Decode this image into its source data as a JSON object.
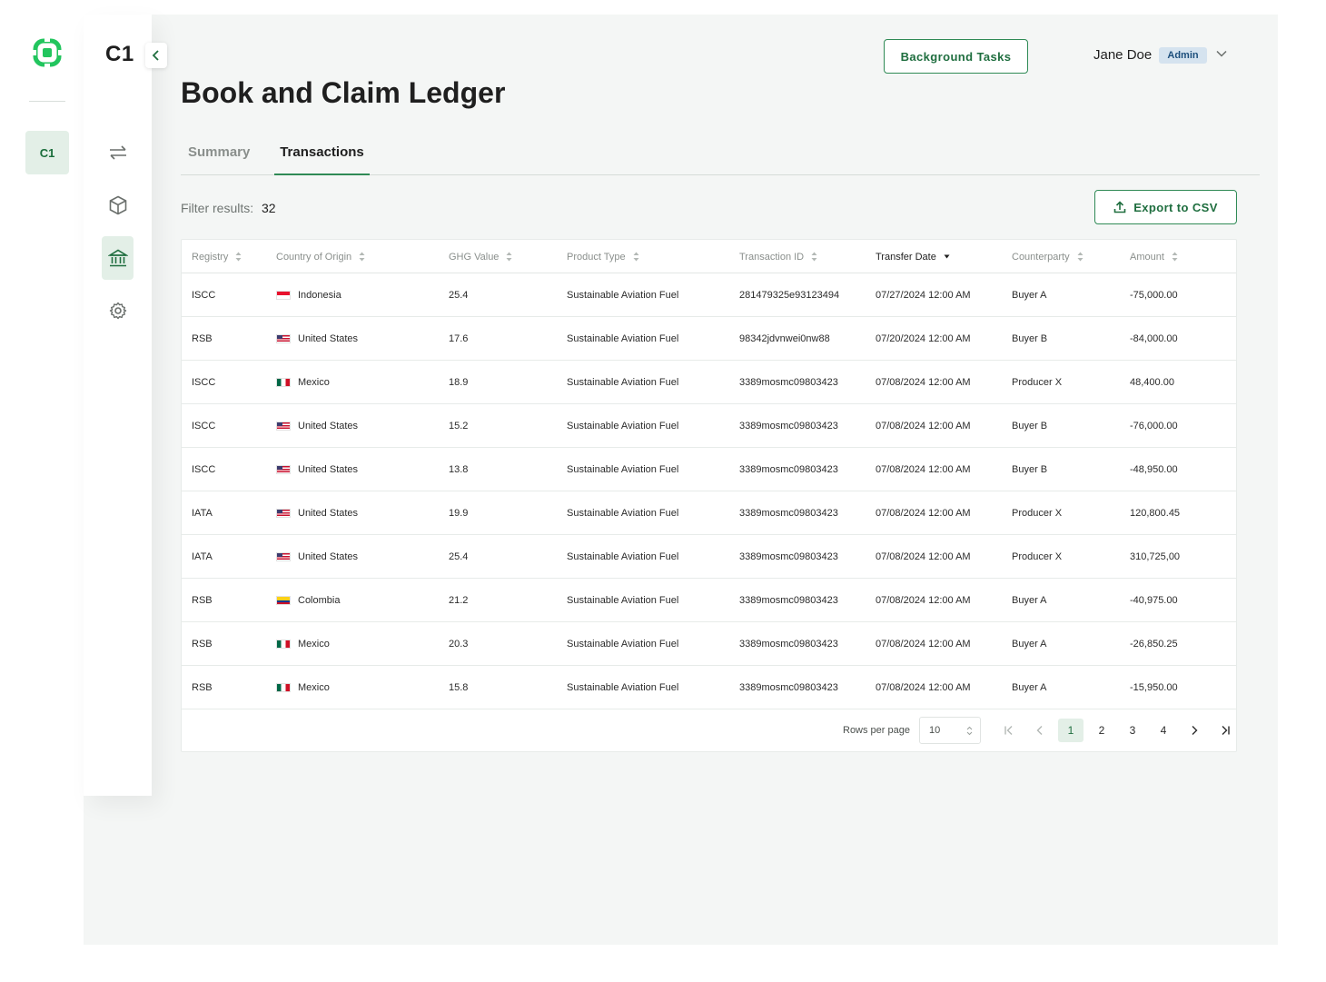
{
  "org": {
    "short_name": "C1",
    "nav_title": "C1"
  },
  "header": {
    "page_title": "Book and Claim Ledger",
    "background_tasks_label": "Background Tasks",
    "user_name": "Jane Doe",
    "user_role": "Admin"
  },
  "nav": {
    "items": [
      {
        "icon": "transfer-arrows-icon",
        "active": false
      },
      {
        "icon": "cube-icon",
        "active": false
      },
      {
        "icon": "bank-icon",
        "active": true
      },
      {
        "icon": "gear-icon",
        "active": false
      }
    ]
  },
  "tabs": [
    {
      "label": "Summary",
      "active": false
    },
    {
      "label": "Transactions",
      "active": true
    }
  ],
  "filter": {
    "label": "Filter results:",
    "count": "32"
  },
  "export_label": "Export to CSV",
  "table": {
    "columns": [
      {
        "label": "Registry",
        "sort": "none"
      },
      {
        "label": "Country of Origin",
        "sort": "none"
      },
      {
        "label": "GHG Value",
        "sort": "none"
      },
      {
        "label": "Product Type",
        "sort": "none"
      },
      {
        "label": "Transaction ID",
        "sort": "none"
      },
      {
        "label": "Transfer Date",
        "sort": "desc"
      },
      {
        "label": "Counterparty",
        "sort": "none"
      },
      {
        "label": "Amount",
        "sort": "none"
      }
    ],
    "rows": [
      {
        "registry": "ISCC",
        "country": "Indonesia",
        "flag": "id",
        "ghg": "25.4",
        "product": "Sustainable Aviation Fuel",
        "txid": "281479325e93123494",
        "date": "07/27/2024 12:00 AM",
        "counterparty": "Buyer A",
        "amount": "-75,000.00"
      },
      {
        "registry": "RSB",
        "country": "United States",
        "flag": "us",
        "ghg": "17.6",
        "product": "Sustainable Aviation Fuel",
        "txid": "98342jdvnwei0nw88",
        "date": "07/20/2024 12:00 AM",
        "counterparty": "Buyer B",
        "amount": "-84,000.00"
      },
      {
        "registry": "ISCC",
        "country": "Mexico",
        "flag": "mx",
        "ghg": "18.9",
        "product": "Sustainable Aviation Fuel",
        "txid": "3389mosmc09803423",
        "date": "07/08/2024 12:00 AM",
        "counterparty": "Producer X",
        "amount": "48,400.00"
      },
      {
        "registry": "ISCC",
        "country": "United States",
        "flag": "us",
        "ghg": "15.2",
        "product": "Sustainable Aviation Fuel",
        "txid": "3389mosmc09803423",
        "date": "07/08/2024 12:00 AM",
        "counterparty": "Buyer B",
        "amount": "-76,000.00"
      },
      {
        "registry": "ISCC",
        "country": "United States",
        "flag": "us",
        "ghg": "13.8",
        "product": "Sustainable Aviation Fuel",
        "txid": "3389mosmc09803423",
        "date": "07/08/2024 12:00 AM",
        "counterparty": "Buyer B",
        "amount": "-48,950.00"
      },
      {
        "registry": "IATA",
        "country": "United States",
        "flag": "us",
        "ghg": "19.9",
        "product": "Sustainable Aviation Fuel",
        "txid": "3389mosmc09803423",
        "date": "07/08/2024 12:00 AM",
        "counterparty": "Producer X",
        "amount": "120,800.45"
      },
      {
        "registry": "IATA",
        "country": "United States",
        "flag": "us",
        "ghg": "25.4",
        "product": "Sustainable Aviation Fuel",
        "txid": "3389mosmc09803423",
        "date": "07/08/2024 12:00 AM",
        "counterparty": "Producer X",
        "amount": "310,725,00"
      },
      {
        "registry": "RSB",
        "country": "Colombia",
        "flag": "co",
        "ghg": "21.2",
        "product": "Sustainable Aviation Fuel",
        "txid": "3389mosmc09803423",
        "date": "07/08/2024 12:00 AM",
        "counterparty": "Buyer A",
        "amount": "-40,975.00"
      },
      {
        "registry": "RSB",
        "country": "Mexico",
        "flag": "mx",
        "ghg": "20.3",
        "product": "Sustainable Aviation Fuel",
        "txid": "3389mosmc09803423",
        "date": "07/08/2024 12:00 AM",
        "counterparty": "Buyer A",
        "amount": "-26,850.25"
      },
      {
        "registry": "RSB",
        "country": "Mexico",
        "flag": "mx",
        "ghg": "15.8",
        "product": "Sustainable Aviation Fuel",
        "txid": "3389mosmc09803423",
        "date": "07/08/2024 12:00 AM",
        "counterparty": "Buyer A",
        "amount": "-15,950.00"
      }
    ]
  },
  "pagination": {
    "rows_per_page_label": "Rows per page",
    "rows_per_page": "10",
    "pages": [
      "1",
      "2",
      "3",
      "4"
    ],
    "current_page": "1"
  },
  "colors": {
    "accent": "#2f8a55",
    "accent_bg": "#e3efe7",
    "logo": "#22c55e"
  }
}
